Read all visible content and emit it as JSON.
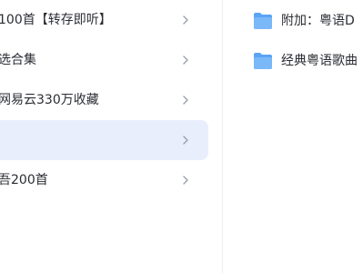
{
  "left_list": {
    "items": [
      {
        "label": "100首【转存即听】",
        "selected": false
      },
      {
        "label": "选合集",
        "selected": false
      },
      {
        "label": "网易云330万收藏",
        "selected": false
      },
      {
        "label": "",
        "selected": true
      },
      {
        "label": "吾200首",
        "selected": false
      }
    ]
  },
  "right_folders": {
    "items": [
      {
        "name": "附加：粤语D"
      },
      {
        "name": "经典粤语歌曲"
      }
    ]
  },
  "colors": {
    "selected_row_bg": "#e9eefc",
    "folder_blue": "#5aa4f5",
    "chevron": "#9aa0aa"
  }
}
